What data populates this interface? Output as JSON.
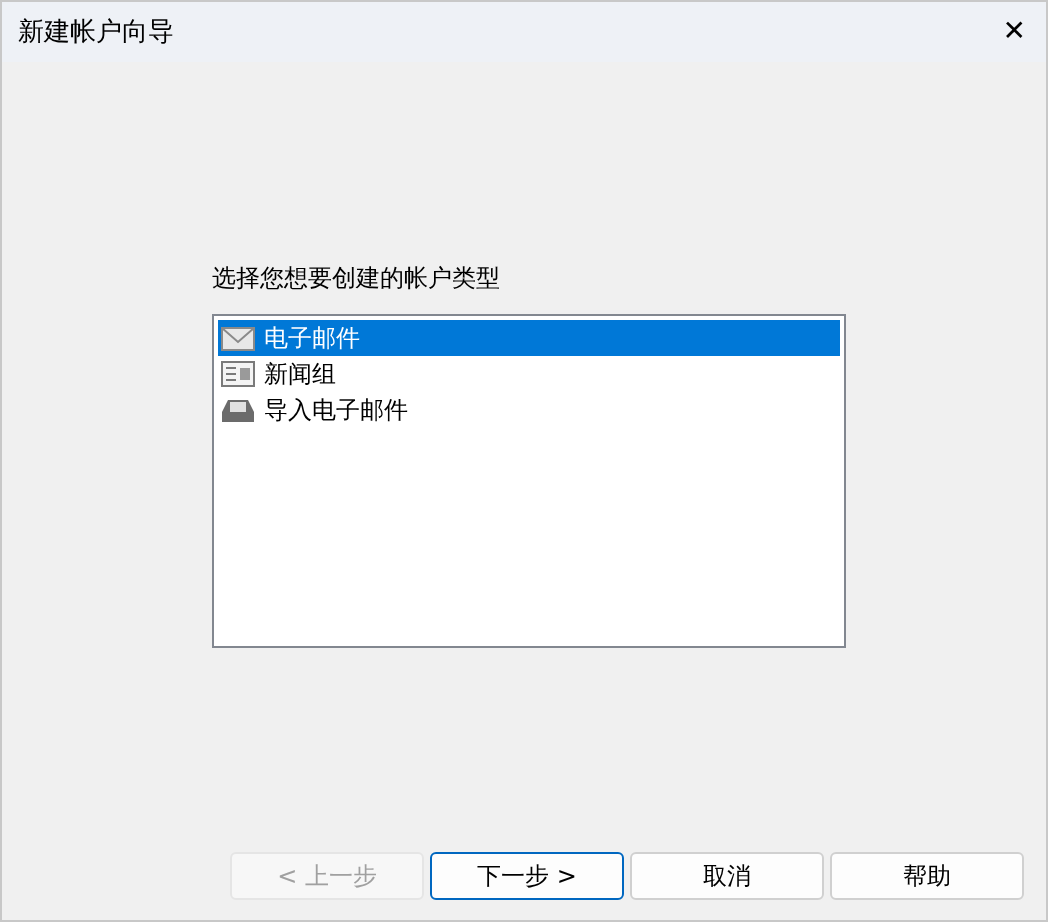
{
  "window": {
    "title": "新建帐户向导",
    "close": "✕"
  },
  "prompt": "选择您想要创建的帐户类型",
  "account_types": [
    {
      "kind": "email",
      "label": "电子邮件",
      "selected": true
    },
    {
      "kind": "news",
      "label": "新闻组",
      "selected": false
    },
    {
      "kind": "import",
      "label": "导入电子邮件",
      "selected": false
    }
  ],
  "buttons": [
    {
      "label": "< 上一步",
      "disabled": true,
      "default": false
    },
    {
      "label": "下一步 >",
      "disabled": false,
      "default": true
    },
    {
      "label": "取消",
      "disabled": false,
      "default": false
    },
    {
      "label": "帮助",
      "disabled": false,
      "default": false
    }
  ]
}
